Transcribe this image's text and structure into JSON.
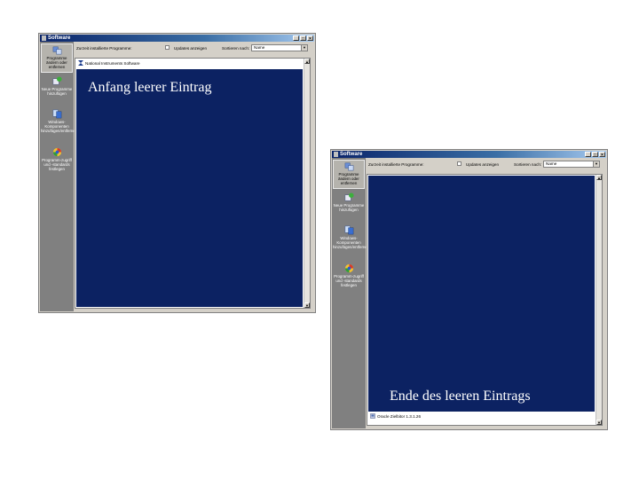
{
  "window_title": "Software",
  "title_buttons": [
    "_",
    "□",
    "×"
  ],
  "sidebar": {
    "items": [
      {
        "label": "Programme ändern oder entfernen",
        "icon": "change-remove-programs-icon"
      },
      {
        "label": "Neue Programme hinzufügen",
        "icon": "add-programs-icon"
      },
      {
        "label": "Windows-Komponenten hinzufügen/entfernen",
        "icon": "windows-components-icon"
      },
      {
        "label": "Programm-zugriff und -standards festlegen",
        "icon": "program-defaults-icon"
      }
    ]
  },
  "toolbar": {
    "installed_label": "Zurzeit installierte Programme:",
    "updates_label": "Updates anzeigen",
    "sort_label": "Sortieren nach:",
    "sort_value": "Name"
  },
  "window1": {
    "first_entry": "National Instruments Software",
    "annotation": "Anfang leerer Eintrag"
  },
  "window2": {
    "last_entry": "Oracle Zielbitor 1.3.1.26",
    "annotation": "Ende des leeren Eintrags"
  },
  "colors": {
    "blank_entry": "#0c2262",
    "sidebar": "#808080",
    "titlebar": "#0a246a"
  }
}
